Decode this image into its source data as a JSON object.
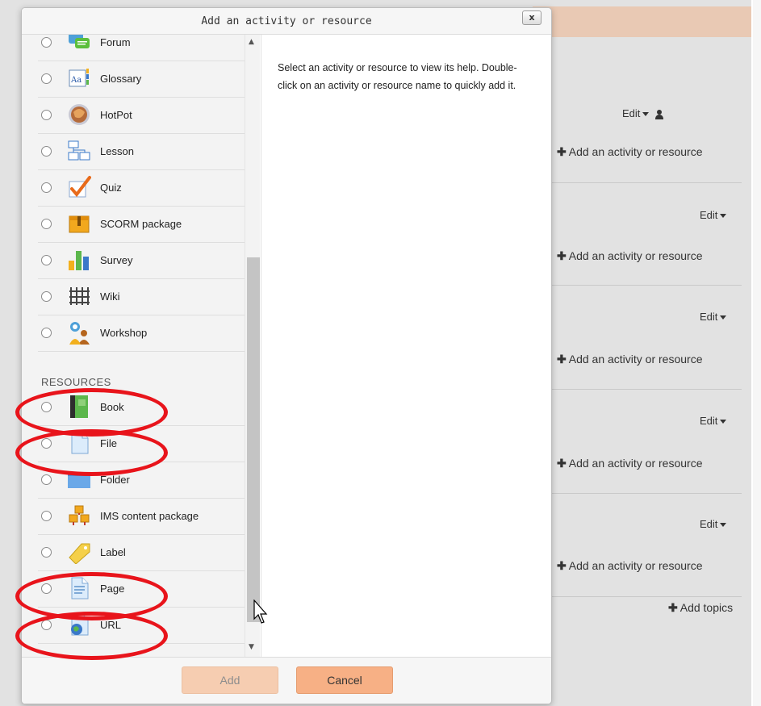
{
  "modal": {
    "title": "Add an activity or resource",
    "close_label": "x",
    "help_text": "Select an activity or resource to view its help. Double-click on an activity or resource name to quickly add it.",
    "add_label": "Add",
    "cancel_label": "Cancel"
  },
  "activities": [
    {
      "label": "Forum",
      "icon": "forum-icon"
    },
    {
      "label": "Glossary",
      "icon": "glossary-icon"
    },
    {
      "label": "HotPot",
      "icon": "hotpot-icon"
    },
    {
      "label": "Lesson",
      "icon": "lesson-icon"
    },
    {
      "label": "Quiz",
      "icon": "quiz-icon"
    },
    {
      "label": "SCORM package",
      "icon": "scorm-icon"
    },
    {
      "label": "Survey",
      "icon": "survey-icon"
    },
    {
      "label": "Wiki",
      "icon": "wiki-icon"
    },
    {
      "label": "Workshop",
      "icon": "workshop-icon"
    }
  ],
  "resources_heading": "RESOURCES",
  "resources": [
    {
      "label": "Book",
      "icon": "book-icon"
    },
    {
      "label": "File",
      "icon": "file-icon"
    },
    {
      "label": "Folder",
      "icon": "folder-icon"
    },
    {
      "label": "IMS content package",
      "icon": "ims-package-icon"
    },
    {
      "label": "Label",
      "icon": "label-icon"
    },
    {
      "label": "Page",
      "icon": "page-icon"
    },
    {
      "label": "URL",
      "icon": "url-icon"
    }
  ],
  "background": {
    "edit_label": "Edit",
    "add_activity_label": "Add an activity or resource",
    "add_topics_label": "Add topics"
  },
  "colors": {
    "highlight": "#e8141b",
    "accent": "#f7b085"
  }
}
